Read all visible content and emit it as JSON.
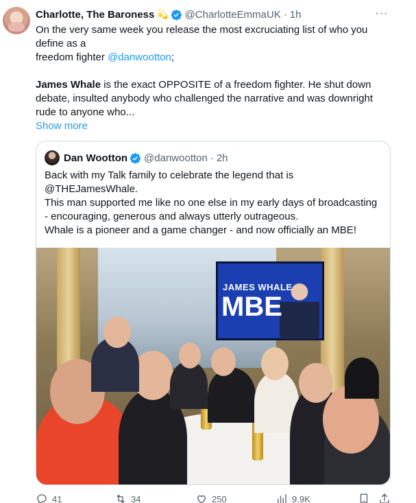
{
  "tweet": {
    "display_name": "Charlotte, The Baroness",
    "handle": "@CharlotteEmmaUK",
    "time": "1h",
    "line1": "On the very same week you release the most excruciating list of who you define as a",
    "line2_prefix": "freedom fighter ",
    "line2_mention": "@danwootton",
    "line2_suffix": ";",
    "para2_bold": "James Whale",
    "para2_rest": " is the exact OPPOSITE of a freedom fighter.  He shut down debate, insulted anybody who challenged the narrative and was downright rude to anyone who...",
    "show_more": "Show more"
  },
  "quote": {
    "display_name": "Dan Wootton",
    "handle": "@danwootton",
    "time": "2h",
    "line1": "Back with my Talk family to celebrate the legend that is",
    "line2": "@THEJamesWhale.",
    "line3": "This man supported me like no one else in my early days of broadcasting - encouraging, generous and always utterly outrageous.",
    "line4": "Whale is a pioneer and a game changer - and now officially an MBE!",
    "photo": {
      "screen_line1": "JAMES WHALE",
      "screen_line2": "MBE"
    }
  },
  "actions": {
    "replies": "41",
    "reposts": "34",
    "likes": "250",
    "views": "9.9K"
  },
  "colors": {
    "accent": "#1d9bf0",
    "secondary_text": "#536471",
    "border": "#cfd9de"
  }
}
